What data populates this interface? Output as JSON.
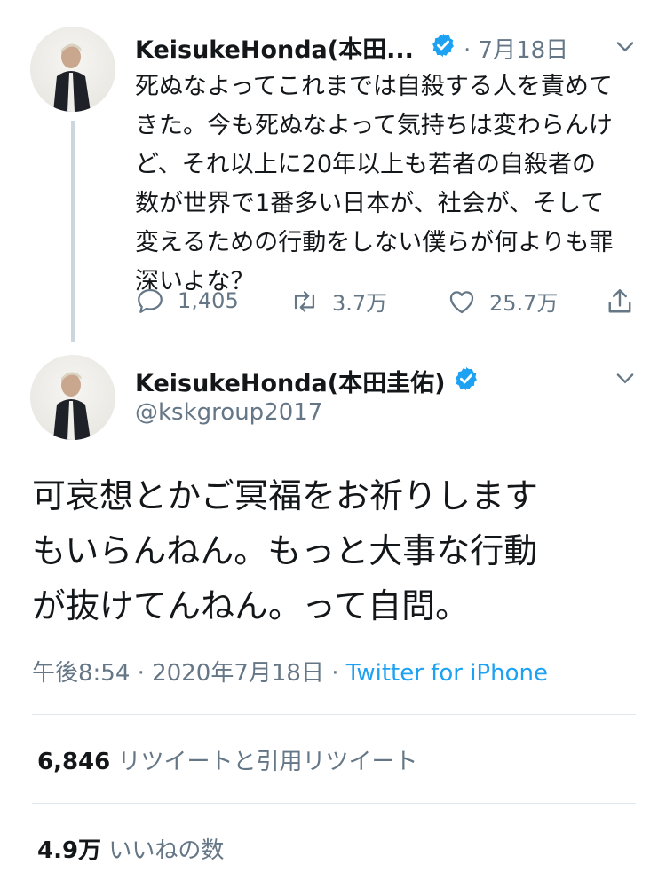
{
  "colors": {
    "accent": "#1da1f2",
    "muted": "#657786",
    "text": "#14171a",
    "divider": "#e1e8ed"
  },
  "tweet1": {
    "name": "KeisukeHonda(本田...",
    "date": "· 7月18日",
    "lines": [
      "死ぬなよってこれまでは自殺する人を責めて",
      "きた。今も死ぬなよって気持ちは変わらんけ",
      "ど、それ以上に20年以上も若者の自殺者の",
      "数が世界で1番多い日本が、社会が、そして",
      "変えるための行動をしない僕らが何よりも罪",
      "深いよな？"
    ],
    "replies": "1,405",
    "retweets": "3.7万",
    "likes": "25.7万"
  },
  "tweet2": {
    "name": "KeisukeHonda(本田圭佑)",
    "handle": "@kskgroup2017",
    "lines": [
      "可哀想とかご冥福をお祈りします",
      "もいらんねん。もっと大事な行動",
      "が抜けてんねん。って自問。"
    ],
    "time": "午後8:54 · 2020年7月18日 · ",
    "source": "Twitter for iPhone",
    "retweets_count": "6,846",
    "retweets_label": "リツイートと引用リツイート",
    "likes_count": "4.9万",
    "likes_label": "いいねの数"
  },
  "icons": [
    "verified-badge-icon",
    "chevron-down-icon",
    "reply-icon",
    "retweet-icon",
    "like-icon",
    "share-icon"
  ]
}
